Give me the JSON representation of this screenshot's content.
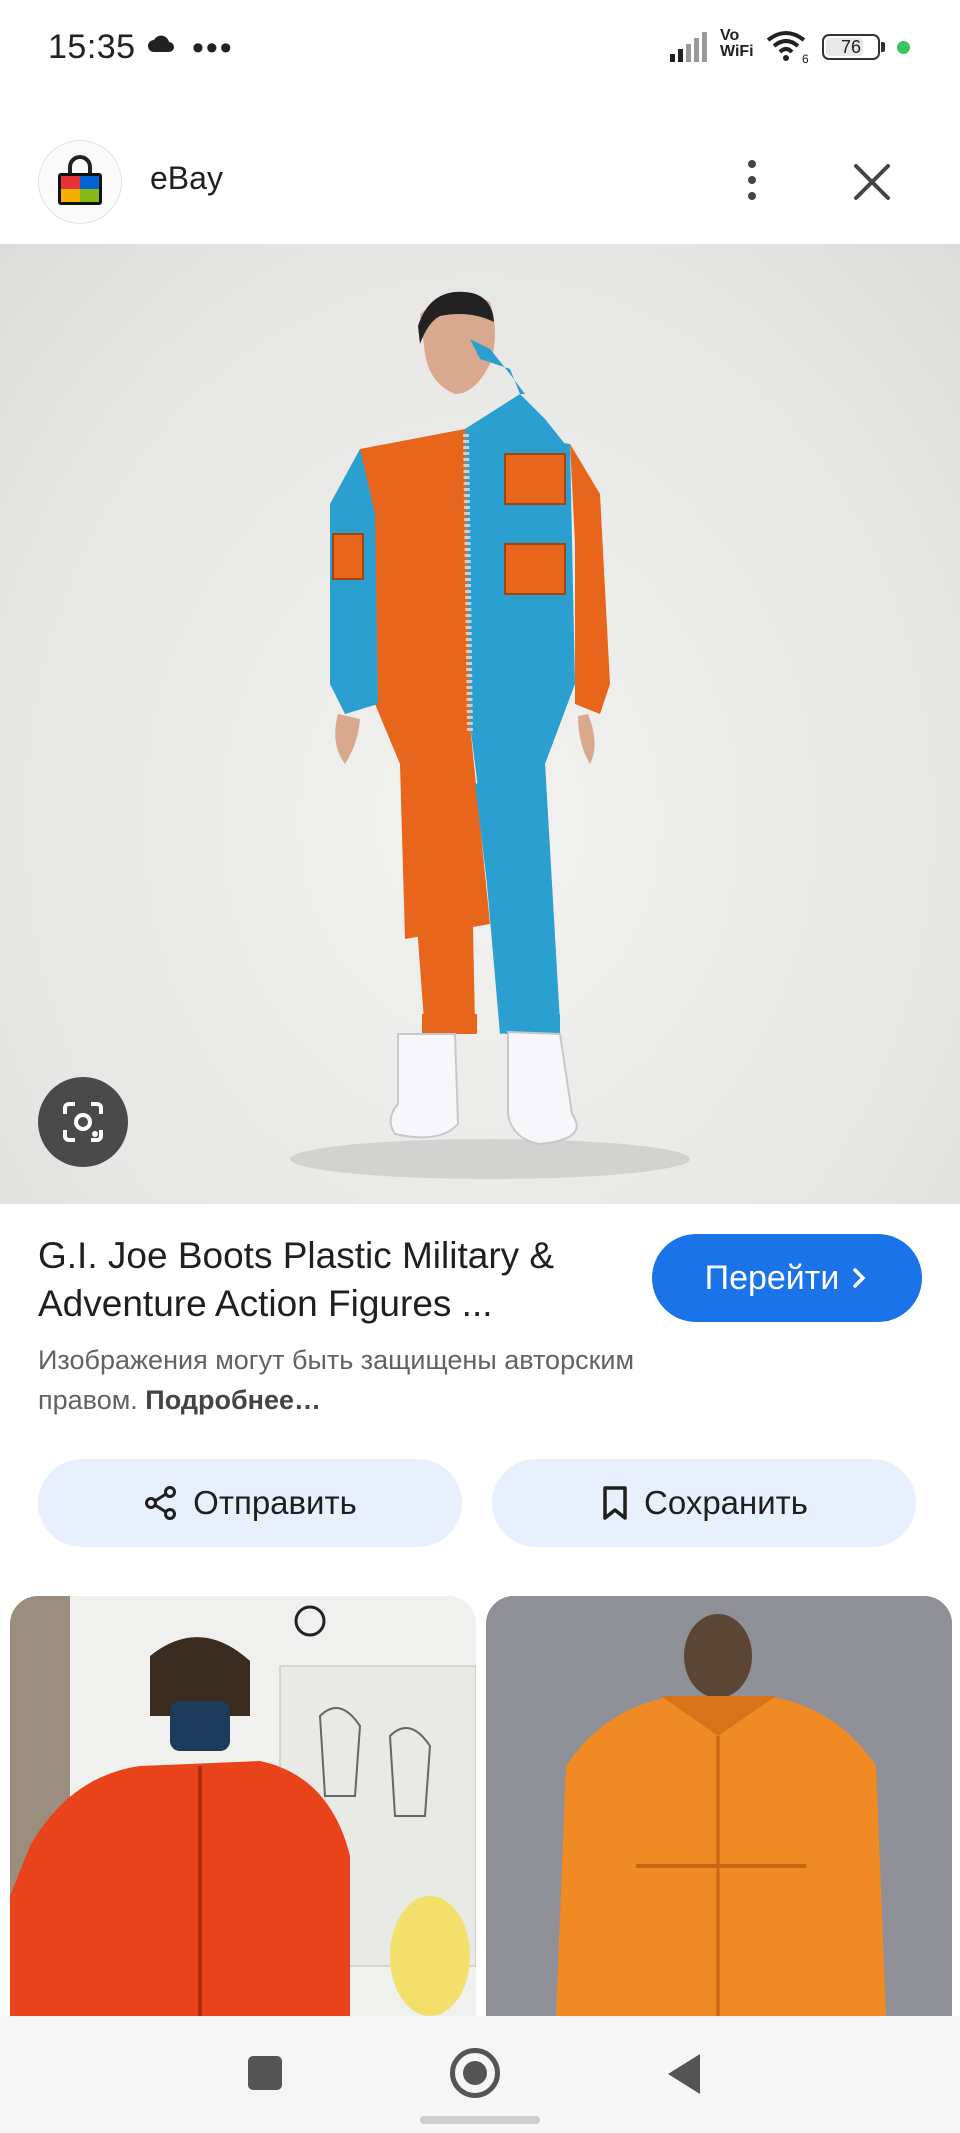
{
  "status_bar": {
    "time": "15:35",
    "dots": "•••",
    "vowifi_top": "Vo",
    "vowifi_bottom": "WiFi",
    "wifi_badge": "6",
    "battery_level": "76",
    "battery_fraction": 0.76,
    "icons": [
      "cloud-icon",
      "more-dots-icon",
      "signal-icon",
      "wifi-icon",
      "battery-icon"
    ]
  },
  "header": {
    "site_name": "eBay",
    "icons": [
      "ebay-bag-logo-icon",
      "more-vert-icon",
      "close-icon"
    ]
  },
  "result": {
    "title": "G.I. Joe Boots Plastic Military & Adventure Action Figures ...",
    "visit_label": "Перейти",
    "copyright_text": "Изображения могут быть защищены авторским правом.",
    "learn_more": "Подробнее…"
  },
  "actions": {
    "share_label": "Отправить",
    "save_label": "Сохранить"
  },
  "colors": {
    "accent": "#1a73e8",
    "chip_bg": "#e8f0fe",
    "jumpsuit_orange": "#e8661c",
    "jumpsuit_blue": "#2a9fd0"
  }
}
